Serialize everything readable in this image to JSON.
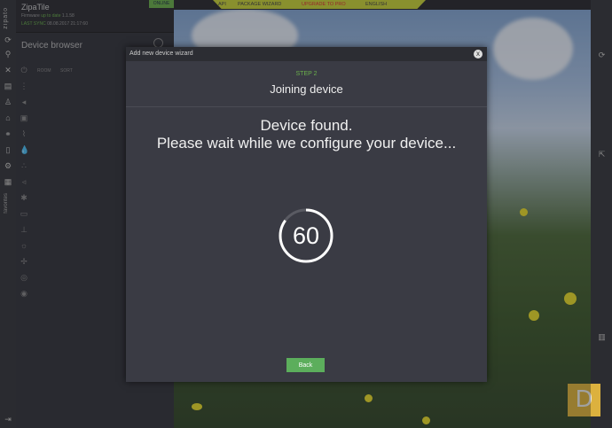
{
  "app": {
    "brand": "zipato",
    "name": "ZipaTile",
    "firmware_prefix": "Firmware",
    "firmware_status": "up to date",
    "firmware_version": "1.1.58",
    "last_sync_label": "LAST SYNC",
    "last_sync_time": "08.08.2017 21:17:60",
    "online_badge": "ONLINE",
    "favorites_label": "favorites"
  },
  "sidebar": {
    "title": "Device browser",
    "filters": [
      "ROOM",
      "SORT"
    ]
  },
  "topnav": {
    "items": [
      "API",
      "PACKAGE WIZARD",
      "UPGRADE TO PRO",
      "ENGLISH"
    ]
  },
  "modal": {
    "title": "Add new device wizard",
    "close_icon": "x",
    "step": "STEP 2",
    "subtitle": "Joining device",
    "line1": "Device found.",
    "line2": "Please wait while we configure your device...",
    "countdown": "60",
    "countdown_progress": 0.85,
    "back_label": "Back"
  },
  "colors": {
    "accent_green": "#6ab04c",
    "nav_yellow": "#c8d33a",
    "upgrade_red": "#d33333",
    "modal_bg": "#3a3b44"
  },
  "logo_letter": "D"
}
